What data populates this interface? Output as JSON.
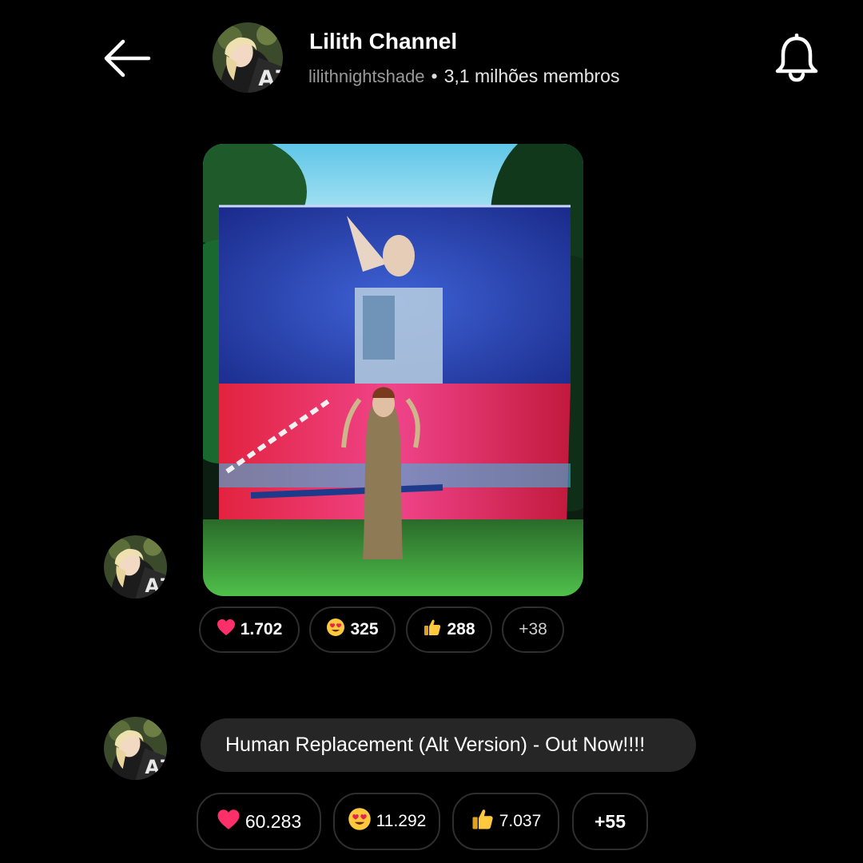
{
  "header": {
    "title": "Lilith Channel",
    "handle": "lilithnightshade",
    "separator": "•",
    "members": "3,1 milhões membros",
    "back_icon": "arrow-left-icon",
    "bell_icon": "bell-icon"
  },
  "posts": [
    {
      "type": "image",
      "reactions": [
        {
          "emoji": "heart",
          "count": "1.702"
        },
        {
          "emoji": "heart-eyes",
          "count": "325"
        },
        {
          "emoji": "thumbs-up",
          "count": "288"
        },
        {
          "emoji": "",
          "count": "+38"
        }
      ]
    },
    {
      "type": "text",
      "text": "Human Replacement (Alt Version) - Out Now!!!!",
      "reactions": [
        {
          "emoji": "heart",
          "count": "60.283"
        },
        {
          "emoji": "heart-eyes",
          "count": "11.292"
        },
        {
          "emoji": "thumbs-up",
          "count": "7.037"
        },
        {
          "emoji": "",
          "count": "+55"
        }
      ]
    }
  ],
  "colors": {
    "background": "#000000",
    "bubble": "#262626",
    "pill_border": "#2e2e2e",
    "muted_text": "#9a9a9a"
  }
}
